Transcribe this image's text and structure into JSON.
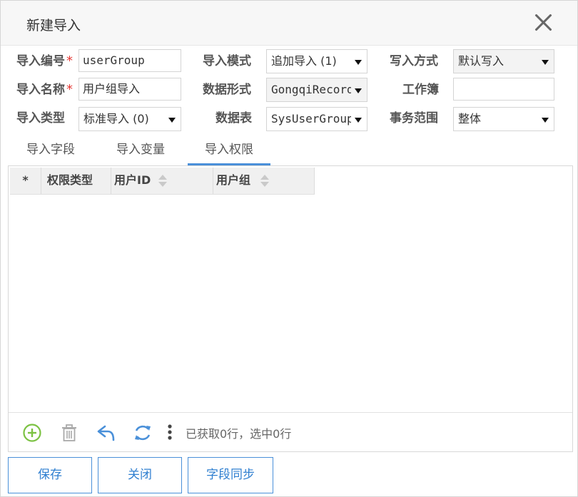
{
  "dialog": {
    "title": "新建导入"
  },
  "form": {
    "import_code": {
      "label": "导入编号",
      "required_mark": "*",
      "value": "userGroup"
    },
    "import_name": {
      "label": "导入名称",
      "required_mark": "*",
      "value": "用户组导入"
    },
    "import_type": {
      "label": "导入类型",
      "value": "标准导入 (0)"
    },
    "import_mode": {
      "label": "导入模式",
      "value": "追加导入 (1)"
    },
    "data_form": {
      "label": "数据形式",
      "value": "GongqiRecord"
    },
    "data_table": {
      "label": "数据表",
      "value": "SysUserGroup"
    },
    "write_method": {
      "label": "写入方式",
      "value": "默认写入"
    },
    "workbook": {
      "label": "工作簿",
      "value": ""
    },
    "transaction_scope": {
      "label": "事务范围",
      "value": "整体"
    }
  },
  "tabs": [
    {
      "label": "导入字段",
      "active": false
    },
    {
      "label": "导入变量",
      "active": false
    },
    {
      "label": "导入权限",
      "active": true
    }
  ],
  "grid": {
    "columns": [
      "*",
      "权限类型",
      "用户ID",
      "用户组"
    ],
    "rows": [],
    "status": "已获取0行，选中0行"
  },
  "toolbar_icons": [
    "add-icon",
    "delete-icon",
    "undo-icon",
    "refresh-icon",
    "more-icon"
  ],
  "buttons": {
    "save": "保存",
    "close": "关闭",
    "sync": "字段同步"
  },
  "colors": {
    "accent": "#4a90d9",
    "required": "#e53935",
    "add_icon": "#7cc243"
  }
}
